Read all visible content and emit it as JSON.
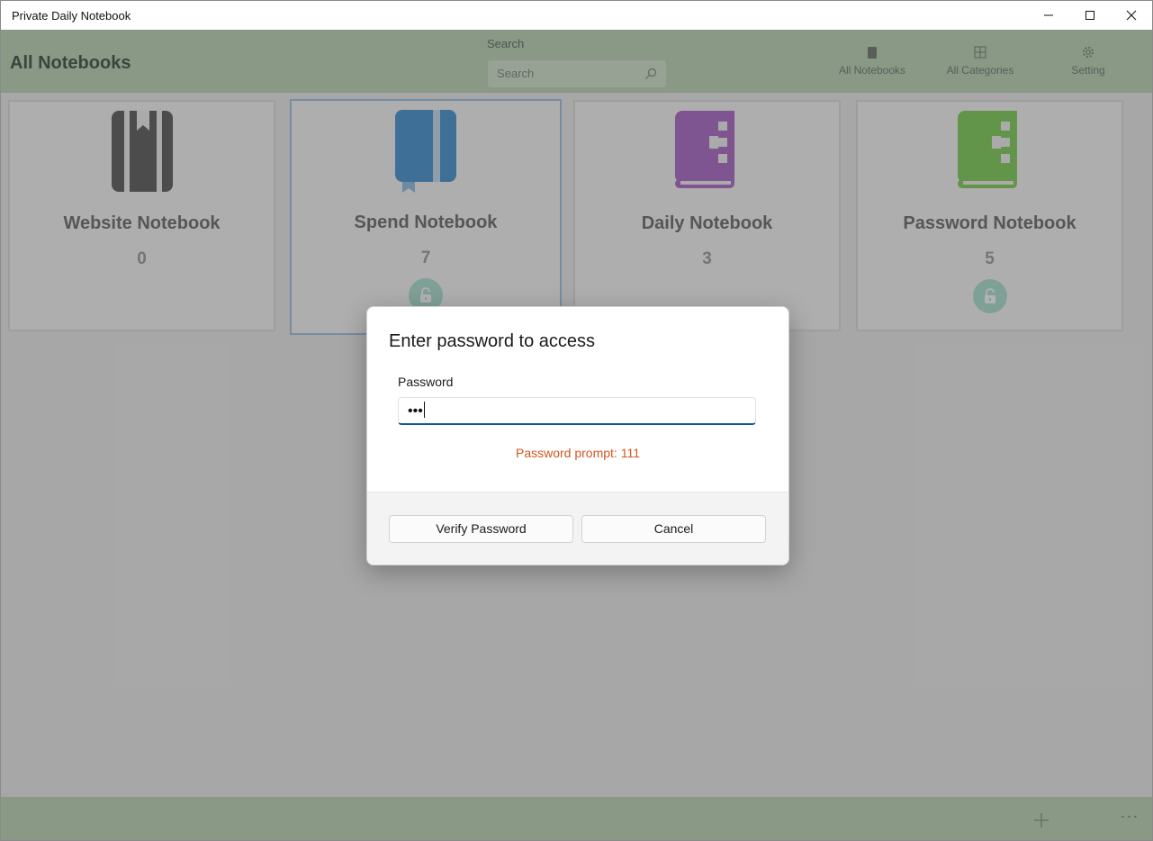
{
  "window": {
    "title": "Private Daily Notebook"
  },
  "header": {
    "title": "All Notebooks",
    "search_label": "Search",
    "search_placeholder": "Search",
    "nav": [
      {
        "label": "All Notebooks",
        "icon": "notebook-icon"
      },
      {
        "label": "All Categories",
        "icon": "grid-icon"
      },
      {
        "label": "Setting",
        "icon": "gear-icon"
      }
    ]
  },
  "notebooks": [
    {
      "name": "Website Notebook",
      "count": "0",
      "icon": "bookmark-book-icon",
      "color": "#6e6e6e",
      "locked": false
    },
    {
      "name": "Spend Notebook",
      "count": "7",
      "icon": "blue-book-icon",
      "color": "#5aa0d8",
      "locked": true,
      "selected": true
    },
    {
      "name": "Daily Notebook",
      "count": "3",
      "icon": "purple-book-icon",
      "color": "#b77ad0",
      "locked": false
    },
    {
      "name": "Password Notebook",
      "count": "5",
      "icon": "green-book-icon",
      "color": "#8dd46a",
      "locked": true
    }
  ],
  "dialog": {
    "title": "Enter password to access",
    "field_label": "Password",
    "password_value": "•••",
    "prompt": "Password prompt: 111",
    "verify_label": "Verify Password",
    "cancel_label": "Cancel"
  },
  "bottombar": {
    "add_icon": "plus-icon",
    "more_icon": "more-icon",
    "more_label": "···"
  },
  "colors": {
    "accent": "#0d5a8e",
    "header_bg": "#c4dcc0",
    "prompt": "#d4551f",
    "lock_bg": "#b6e6d8"
  }
}
